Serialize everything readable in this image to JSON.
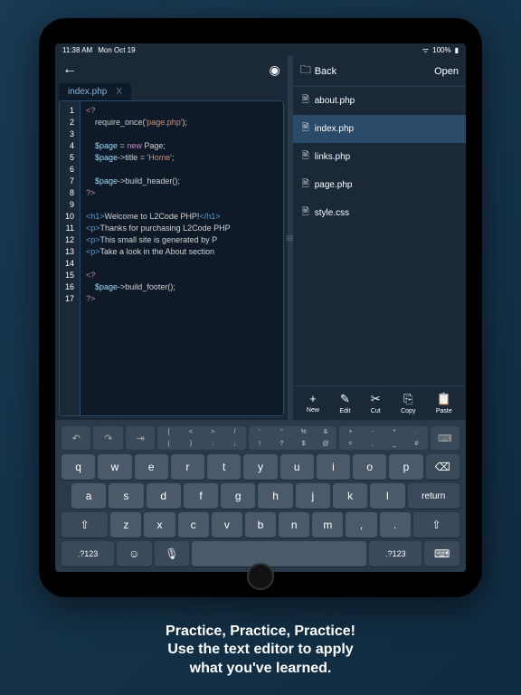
{
  "status": {
    "time": "11:38 AM",
    "date": "Mon Oct 19",
    "wifi": "●",
    "battery": "100%"
  },
  "editor": {
    "tab_name": "index.php",
    "tab_close": "X",
    "lines": [
      "1",
      "2",
      "3",
      "4",
      "5",
      "6",
      "7",
      "8",
      "9",
      "10",
      "11",
      "12",
      "13",
      "14",
      "15",
      "16",
      "17"
    ]
  },
  "code": {
    "l1": "<?",
    "l2_a": "    require_once(",
    "l2_b": "'page.php'",
    "l2_c": ");",
    "l4_a": "    $page",
    "l4_b": " = ",
    "l4_c": "new",
    "l4_d": " Page;",
    "l5_a": "    $page",
    "l5_b": "->title = ",
    "l5_c": "'Home'",
    "l5_d": ";",
    "l7_a": "    $page",
    "l7_b": "->build_header();",
    "l8": "?>",
    "l10_a": "<h1>",
    "l10_b": "Welcome to L2Code PHP!",
    "l10_c": "</h1>",
    "l11_a": "<p>",
    "l11_b": "Thanks for purchasing L2Code PHP",
    "l12_a": "<p>",
    "l12_b": "This small site is generated by P",
    "l13_a": "<p>",
    "l13_b": "Take a look in the About section",
    "l15": "<?",
    "l16_a": "    $page",
    "l16_b": "->build_footer();",
    "l17": "?>"
  },
  "files": {
    "back": "Back",
    "open": "Open",
    "items": [
      {
        "name": "about.php"
      },
      {
        "name": "index.php"
      },
      {
        "name": "links.php"
      },
      {
        "name": "page.php"
      },
      {
        "name": "style.css"
      }
    ]
  },
  "toolbar": {
    "new": "New",
    "edit": "Edit",
    "cut": "Cut",
    "copy": "Copy",
    "paste": "Paste"
  },
  "keyboard": {
    "row1": [
      "q",
      "w",
      "e",
      "r",
      "t",
      "y",
      "u",
      "i",
      "o",
      "p"
    ],
    "row2": [
      "a",
      "s",
      "d",
      "f",
      "g",
      "h",
      "j",
      "k",
      "l"
    ],
    "row3": [
      "z",
      "x",
      "c",
      "v",
      "b",
      "n",
      "m"
    ],
    "shift": "⇧",
    "backspace": "⌫",
    "numkey": ".?123",
    "emoji": "☺",
    "mic": "🎤",
    "return": "return",
    "hide": "⌨"
  },
  "caption": {
    "l1": "Practice, Practice, Practice!",
    "l2": "Use the text editor to apply",
    "l3": "what you've learned."
  }
}
